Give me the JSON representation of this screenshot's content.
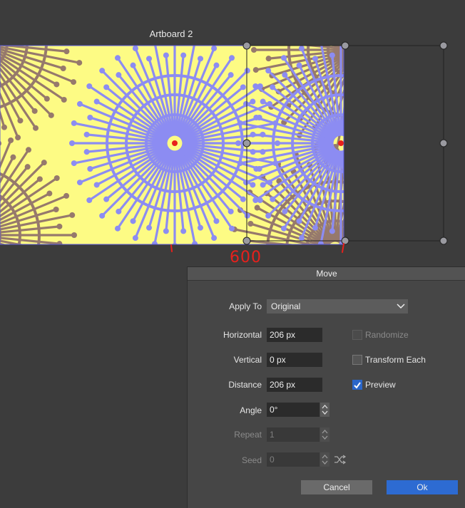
{
  "artboard": {
    "title": "Artboard 2",
    "colors": {
      "background": "#fdfb84",
      "brown": "#96796c",
      "purple": "#8c8cf2",
      "border": "#6666cc",
      "annotation": "#e8201c"
    }
  },
  "annotations": {
    "measure_label": "600",
    "question_mark": "?"
  },
  "dialog": {
    "title": "Move",
    "apply_to": {
      "label": "Apply To",
      "value": "Original"
    },
    "horizontal": {
      "label": "Horizontal",
      "value": "206 px"
    },
    "vertical": {
      "label": "Vertical",
      "value": "0 px"
    },
    "distance": {
      "label": "Distance",
      "value": "206 px"
    },
    "angle": {
      "label": "Angle",
      "value": "0°"
    },
    "repeat": {
      "label": "Repeat",
      "value": "1"
    },
    "seed": {
      "label": "Seed",
      "value": "0"
    },
    "randomize": {
      "label": "Randomize",
      "checked": false,
      "enabled": false
    },
    "transform_each": {
      "label": "Transform Each",
      "checked": false
    },
    "preview": {
      "label": "Preview",
      "checked": true
    },
    "cancel_label": "Cancel",
    "ok_label": "Ok"
  }
}
